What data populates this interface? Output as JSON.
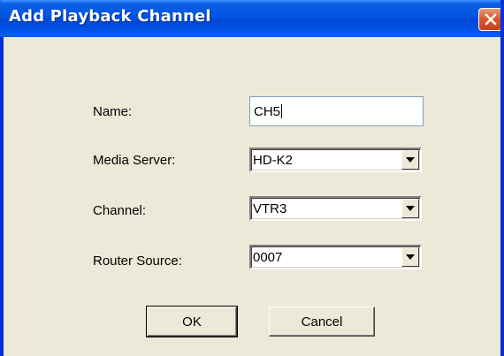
{
  "window": {
    "title": "Add Playback Channel"
  },
  "form": {
    "name": {
      "label": "Name:",
      "value": "CH5"
    },
    "media_server": {
      "label": "Media Server:",
      "value": "HD-K2"
    },
    "channel": {
      "label": "Channel:",
      "value": "VTR3"
    },
    "router_source": {
      "label": "Router Source:",
      "value": "0007"
    }
  },
  "buttons": {
    "ok": "OK",
    "cancel": "Cancel"
  },
  "icons": {
    "close": "close-icon",
    "dropdown": "chevron-down-icon"
  },
  "colors": {
    "titlebar": "#0254E0",
    "dialog_bg": "#ECE9D8",
    "close_button": "#D9582E"
  }
}
